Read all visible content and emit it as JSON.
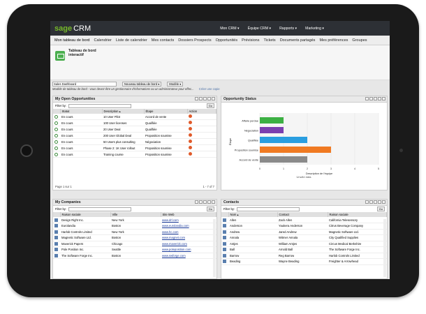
{
  "brand": {
    "sage": "sage",
    "crm": "CRM"
  },
  "topnav": [
    "Mon CRM ▾",
    "Équipe CRM ▾",
    "Rapports ▾",
    "Marketing ▾"
  ],
  "subnav": [
    "Mon tableau de bord",
    "Calendrier",
    "Liste de calendrier",
    "Mes contacts",
    "Dossiers Prospects",
    "Opportunités",
    "Prévisions",
    "Tickets",
    "Documents partagés",
    "Mes préférences",
    "Groupes"
  ],
  "header": {
    "title": "Tableau de bord interactif"
  },
  "dashboard": {
    "select": "Sales Dashboard",
    "new_btn": "Nouveau tableau de bord ▾",
    "model_btn": "Modèle ▾",
    "notice": "Modèle de tableau de bord - vous devez être un gestionnaire d'informations ou un administrateur pour effec...",
    "copy_link": "Créer une copie"
  },
  "opps": {
    "title": "My Open Opportunities",
    "filter": "Filter by:",
    "go": "Go",
    "headers": [
      "",
      "Statut",
      "Description ▴",
      "Étape",
      "Action"
    ],
    "rows": [
      [
        "En cours",
        "10 User Pilot",
        "Accord de vente"
      ],
      [
        "En cours",
        "100 User licenses",
        "Qualifiée"
      ],
      [
        "En cours",
        "20 User Deal",
        "Qualifiée"
      ],
      [
        "En cours",
        "200 User Global Deal",
        "Proposition soumise"
      ],
      [
        "En cours",
        "50 Users plus consulting",
        "Négociation"
      ],
      [
        "En cours",
        "Phase 2: 1K User rollout",
        "Proposition soumise"
      ],
      [
        "En cours",
        "Training course",
        "Proposition soumise"
      ]
    ],
    "pagination": "Page 1 sur 1",
    "count": "1 - 7 of 7"
  },
  "status": {
    "title": "Opportunity Status",
    "footnote": "Unwild data.",
    "xlabel": "Description de l'équipe",
    "ylabel": "Étape"
  },
  "chart_data": {
    "type": "bar",
    "categories": [
      "Affaire perdue",
      "Négociation",
      "Qualifiée",
      "Proposition soumise",
      "Accord de vente"
    ],
    "values": [
      1,
      1,
      2,
      3,
      2
    ],
    "xlim": [
      0,
      5
    ],
    "colors": [
      "#3cb043",
      "#7b3fb0",
      "#2a9ee0",
      "#f07a22",
      "#8a8a8a"
    ]
  },
  "companies": {
    "title": "My Companies",
    "filter": "Filter by:",
    "go": "Go",
    "headers": [
      "",
      "Raison sociale",
      "Ville",
      "Site Web"
    ],
    "rows": [
      [
        "Design Right Inc.",
        "New York",
        "www.drl.com"
      ],
      [
        "Eurolandia",
        "Boston",
        "www.eurolandia.com"
      ],
      [
        "Harlob Controls Limited",
        "New York",
        "www.hc.com"
      ],
      [
        "Magnetic Software Ltd.",
        "Boston",
        "www.magnet.com"
      ],
      [
        "Maverick Papers",
        "Chicago",
        "www.maverick.com"
      ],
      [
        "Pole Position Inc.",
        "Seattle",
        "www.poleposition.com"
      ],
      [
        "The Software Forge Inc.",
        "Boston",
        "www.swforge.com"
      ]
    ]
  },
  "contacts": {
    "title": "Contacts",
    "filter": "Filter by:",
    "go": "Go",
    "headers": [
      "",
      "Nom ▴",
      "Contact",
      "Raison sociale"
    ],
    "rows": [
      [
        "Allen",
        "Zack Allen",
        "California Telesensory"
      ],
      [
        "Anderson",
        "Yaukera Anderson",
        "Citrus Beverage Company"
      ],
      [
        "Andrew",
        "Jared Andrew",
        "Magnetic Software Ltd."
      ],
      [
        "Annala",
        "Witmer Annala",
        "City Qualified Supplies"
      ],
      [
        "Antjes",
        "William Antjes",
        "Circus Medical Berkshire"
      ],
      [
        "Ball",
        "Arnold Ball",
        "The Software Forge Inc."
      ],
      [
        "Barrow",
        "Reg Barrow",
        "Harlob Controls Limited"
      ],
      [
        "Beading",
        "Wayne Beading",
        "Freighter & Arrowhead"
      ]
    ]
  }
}
